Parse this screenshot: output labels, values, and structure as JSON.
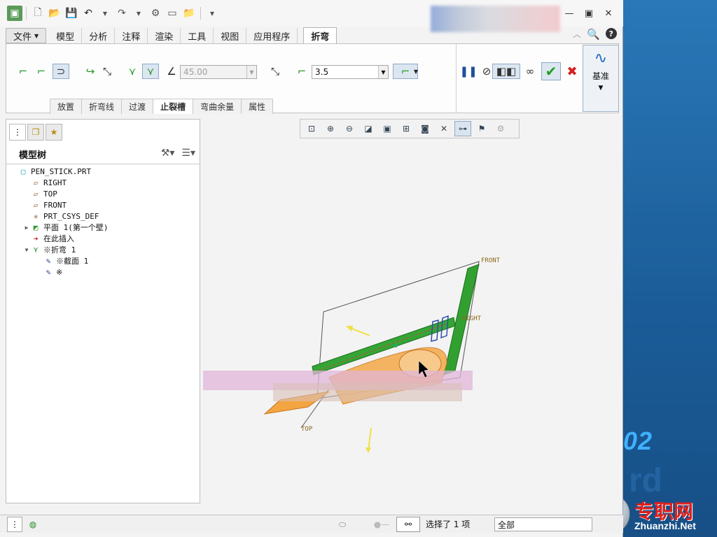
{
  "window": {
    "minimize_icon": "minimize-icon",
    "maximize_icon": "maximize-icon",
    "close_icon": "close-icon"
  },
  "ribbon": {
    "tabs": [
      {
        "label": "文件"
      },
      {
        "label": "模型"
      },
      {
        "label": "分析"
      },
      {
        "label": "注释"
      },
      {
        "label": "渲染"
      },
      {
        "label": "工具"
      },
      {
        "label": "视图"
      },
      {
        "label": "应用程序"
      },
      {
        "label": "折弯"
      }
    ],
    "active_tab": "折弯",
    "angle_value": "45.00",
    "radius_value": "3.5",
    "subtabs": [
      "放置",
      "折弯线",
      "过渡",
      "止裂槽",
      "弯曲余量",
      "属性"
    ],
    "active_subtab": "止裂槽",
    "datum_label": "基准"
  },
  "model_tree": {
    "title": "模型树",
    "items": [
      {
        "label": "PEN_STICK.PRT",
        "indent": 0,
        "icon": "part-icon",
        "expander": ""
      },
      {
        "label": "RIGHT",
        "indent": 1,
        "icon": "datum-plane-icon",
        "expander": ""
      },
      {
        "label": "TOP",
        "indent": 1,
        "icon": "datum-plane-icon",
        "expander": ""
      },
      {
        "label": "FRONT",
        "indent": 1,
        "icon": "datum-plane-icon",
        "expander": ""
      },
      {
        "label": "PRT_CSYS_DEF",
        "indent": 1,
        "icon": "csys-icon",
        "expander": ""
      },
      {
        "label": "平面 1(第一个壁)",
        "indent": 1,
        "icon": "wall-icon",
        "expander": "▶"
      },
      {
        "label": "在此插入",
        "indent": 1,
        "icon": "insert-arrow-icon",
        "expander": ""
      },
      {
        "label": "※折弯 1",
        "indent": 1,
        "icon": "bend-icon",
        "expander": "▼"
      },
      {
        "label": "※截面 1",
        "indent": 2,
        "icon": "sketch-icon",
        "expander": ""
      },
      {
        "label": "※",
        "indent": 2,
        "icon": "sketch-icon",
        "expander": ""
      }
    ]
  },
  "graphics": {
    "datum_labels": {
      "front": "FRONT",
      "right": "RIGHT",
      "top": "TOP"
    }
  },
  "status": {
    "message": "选择了 1 项",
    "filter": "全部"
  },
  "desktop": {
    "number_text": "02",
    "ghost_text": "rd",
    "watermark_cn": "专职网",
    "watermark_en": "Zhuanzhi.Net"
  }
}
